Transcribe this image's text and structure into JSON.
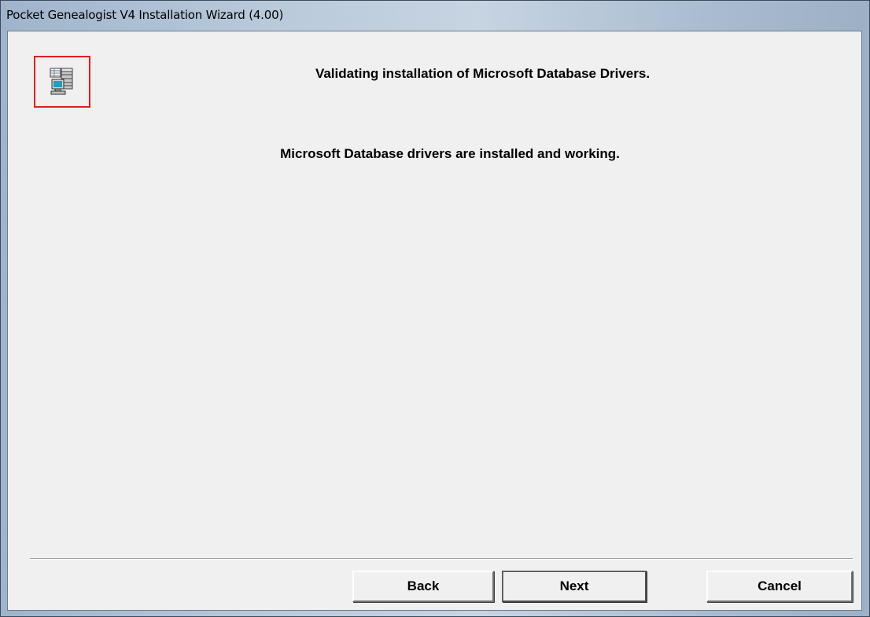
{
  "window": {
    "title": "Pocket Genealogist V4 Installation Wizard (4.00)"
  },
  "header": {
    "icon": "database-computer-icon",
    "heading": "Validating installation of Microsoft Database Drivers."
  },
  "main": {
    "status_message": "Microsoft Database drivers are installed and working."
  },
  "buttons": {
    "back_label": "Back",
    "next_label": "Next",
    "cancel_label": "Cancel"
  },
  "colors": {
    "client_background": "#f0f0f0",
    "icon_highlight_border": "#e02020"
  }
}
